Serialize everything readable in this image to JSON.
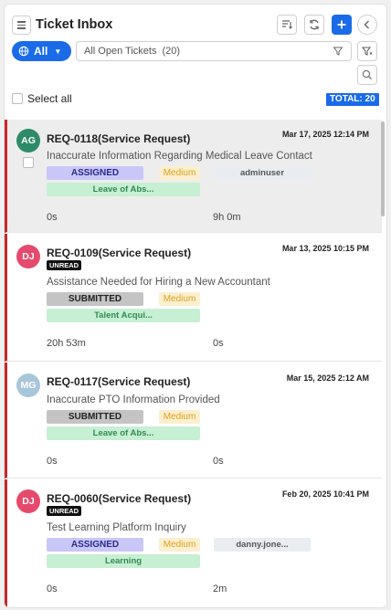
{
  "header": {
    "title": "Ticket Inbox",
    "all_label": "All",
    "search_text": "All Open Tickets",
    "search_count": "(20)",
    "select_all_label": "Select all",
    "total_label": "TOTAL: 20"
  },
  "colors": {
    "accent": "#1a6be8",
    "unread_bar": "#c9262b"
  },
  "icons": [
    "menu-icon",
    "sort-icon",
    "refresh-icon",
    "plus-icon",
    "chevron-left-icon",
    "globe-icon",
    "chevron-down-icon",
    "filter-icon",
    "filter-settings-icon",
    "search-icon"
  ],
  "tickets": [
    {
      "initials": "AG",
      "avatar_color": "#2e8b69",
      "request": "REQ-0118(Service Request)",
      "date": "Mar 17, 2025 12:14 PM",
      "unread": "",
      "subject": "Inaccurate Information Regarding Medical Leave Contact",
      "status": "ASSIGNED",
      "priority": "Medium",
      "assignee": "adminuser",
      "category": "Leave of Abs...",
      "time_1": "0s",
      "time_2": "9h 0m"
    },
    {
      "initials": "DJ",
      "avatar_color": "#e54a6c",
      "request": "REQ-0109(Service Request)",
      "date": "Mar 13, 2025 10:15 PM",
      "unread": "UNREAD",
      "subject": "Assistance Needed for Hiring a New Accountant",
      "status": "SUBMITTED",
      "priority": "Medium",
      "assignee": "",
      "category": "Talent Acqui...",
      "time_1": "20h 53m",
      "time_2": "0s"
    },
    {
      "initials": "MG",
      "avatar_color": "#a8c6d9",
      "request": "REQ-0117(Service Request)",
      "date": "Mar 15, 2025 2:12 AM",
      "unread": "",
      "subject": "Inaccurate PTO Information Provided",
      "status": "SUBMITTED",
      "priority": "Medium",
      "assignee": "",
      "category": "Leave of Abs...",
      "time_1": "0s",
      "time_2": "0s"
    },
    {
      "initials": "DJ",
      "avatar_color": "#e54a6c",
      "request": "REQ-0060(Service Request)",
      "date": "Feb 20, 2025 10:41 PM",
      "unread": "UNREAD",
      "subject": "Test Learning Platform Inquiry",
      "status": "ASSIGNED",
      "priority": "Medium",
      "assignee": "danny.jone...",
      "category": "Learning",
      "time_1": "0s",
      "time_2": "2m"
    }
  ]
}
